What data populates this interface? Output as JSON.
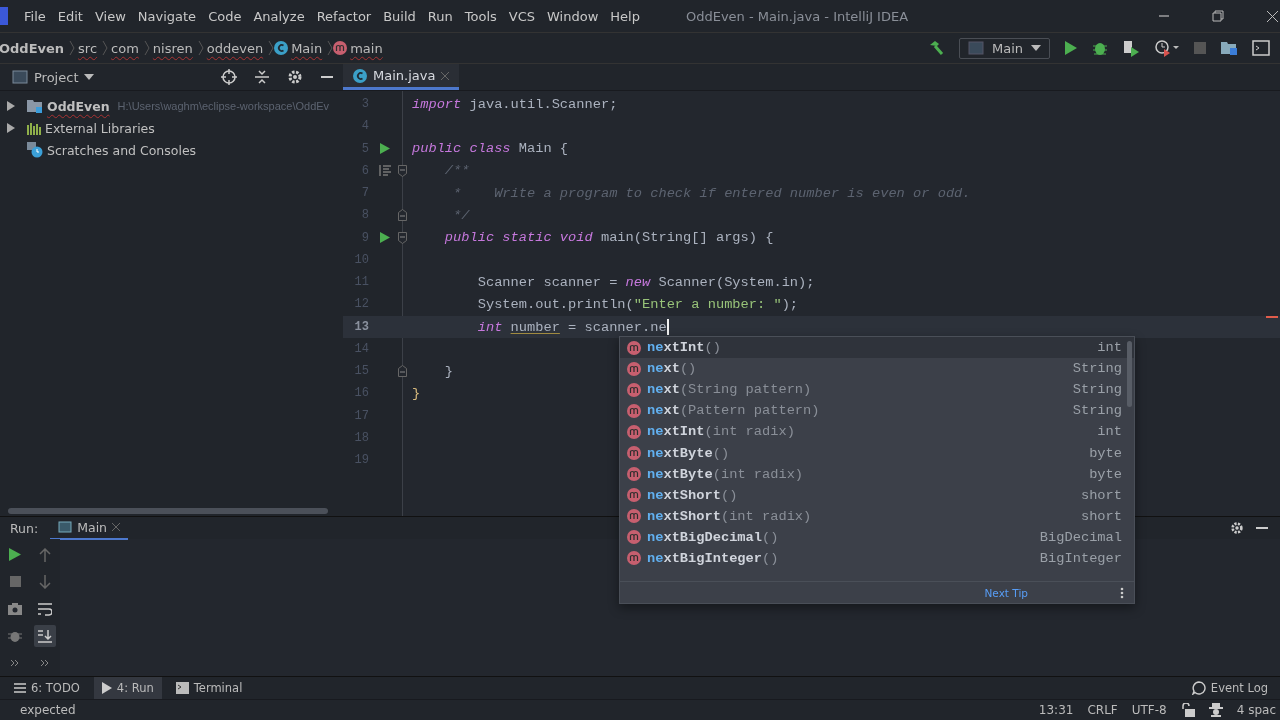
{
  "window": {
    "title": "OddEven - Main.java - IntelliJ IDEA"
  },
  "menu": [
    "File",
    "Edit",
    "View",
    "Navigate",
    "Code",
    "Analyze",
    "Refactor",
    "Build",
    "Run",
    "Tools",
    "VCS",
    "Window",
    "Help"
  ],
  "breadcrumbs": [
    {
      "label": "OddEven",
      "kind": "project"
    },
    {
      "label": "src",
      "kind": "folder"
    },
    {
      "label": "com",
      "kind": "folder"
    },
    {
      "label": "nisren",
      "kind": "folder"
    },
    {
      "label": "oddeven",
      "kind": "folder"
    },
    {
      "label": "Main",
      "kind": "class"
    },
    {
      "label": "main",
      "kind": "method"
    }
  ],
  "run_config": {
    "label": "Main"
  },
  "project_panel": {
    "title": "Project",
    "tree": [
      {
        "label": "OddEven",
        "path": "H:\\Users\\waghm\\eclipse-workspace\\OddEv",
        "kind": "module",
        "expanded": false
      },
      {
        "label": "External Libraries",
        "kind": "libraries",
        "expanded": false
      },
      {
        "label": "Scratches and Consoles",
        "kind": "scratches"
      }
    ]
  },
  "editor": {
    "tabs": [
      {
        "label": "Main.java",
        "selected": true
      }
    ],
    "lines": [
      {
        "number": "3",
        "current": false,
        "runnable": false,
        "doc": false,
        "fold_open": false,
        "fold_close": false,
        "tokens": [
          {
            "kind": "keyword",
            "text": "import"
          },
          {
            "kind": "plain",
            "text": " java.util.Scanner;"
          }
        ]
      },
      {
        "number": "4",
        "current": false,
        "runnable": false,
        "doc": false,
        "fold_open": false,
        "fold_close": false
      },
      {
        "number": "5",
        "current": false,
        "runnable": true,
        "doc": false,
        "fold_open": false,
        "fold_close": false,
        "tokens": [
          {
            "kind": "keyword",
            "text": "public class"
          },
          {
            "kind": "plain",
            "text": " Main {"
          }
        ]
      },
      {
        "number": "6",
        "current": false,
        "runnable": false,
        "doc": true,
        "fold_open": true,
        "fold_close": false,
        "tokens": [
          {
            "kind": "comment",
            "text": "    /**"
          }
        ]
      },
      {
        "number": "7",
        "current": false,
        "runnable": false,
        "doc": false,
        "fold_open": false,
        "fold_close": false,
        "tokens": [
          {
            "kind": "comment",
            "text": "     *    Write a program to check if entered number is even or odd."
          }
        ]
      },
      {
        "number": "8",
        "current": false,
        "runnable": false,
        "doc": false,
        "fold_open": false,
        "fold_close": true,
        "tokens": [
          {
            "kind": "comment",
            "text": "     */"
          }
        ]
      },
      {
        "number": "9",
        "current": false,
        "runnable": true,
        "doc": false,
        "fold_open": true,
        "fold_close": false,
        "tokens": [
          {
            "kind": "keyword",
            "text": "    public static void"
          },
          {
            "kind": "plain",
            "text": " main(String[] args) {"
          }
        ]
      },
      {
        "number": "10",
        "current": false,
        "runnable": false,
        "doc": false,
        "fold_open": false,
        "fold_close": false
      },
      {
        "number": "11",
        "current": false,
        "runnable": false,
        "doc": false,
        "fold_open": false,
        "fold_close": false,
        "tokens": [
          {
            "kind": "plain",
            "text": "        Scanner scanner = "
          },
          {
            "kind": "keyword",
            "text": "new"
          },
          {
            "kind": "plain",
            "text": " Scanner(System.in);"
          }
        ]
      },
      {
        "number": "12",
        "current": false,
        "runnable": false,
        "doc": false,
        "fold_open": false,
        "fold_close": false,
        "tokens": [
          {
            "kind": "plain",
            "text": "        System.out.println("
          },
          {
            "kind": "string",
            "text": "\"Enter a number: \""
          },
          {
            "kind": "plain",
            "text": ");"
          }
        ]
      },
      {
        "number": "13",
        "current": true,
        "runnable": false,
        "doc": false,
        "fold_open": false,
        "fold_close": false,
        "tokens": [
          {
            "kind": "keyword",
            "text": "        int "
          },
          {
            "kind": "warning",
            "text": "number"
          },
          {
            "kind": "plain",
            "text": " = scanner.ne"
          }
        ]
      },
      {
        "number": "14",
        "current": false,
        "runnable": false,
        "doc": false,
        "fold_open": false,
        "fold_close": false
      },
      {
        "number": "15",
        "current": false,
        "runnable": false,
        "doc": false,
        "fold_open": false,
        "fold_close": true,
        "tokens": [
          {
            "kind": "plain",
            "text": "    }"
          }
        ]
      },
      {
        "number": "16",
        "current": false,
        "runnable": false,
        "doc": false,
        "fold_open": false,
        "fold_close": false,
        "tokens": [
          {
            "kind": "brace",
            "text": "}"
          }
        ]
      },
      {
        "number": "17",
        "current": false,
        "runnable": false,
        "doc": false,
        "fold_open": false,
        "fold_close": false
      },
      {
        "number": "18",
        "current": false,
        "runnable": false,
        "doc": false,
        "fold_open": false,
        "fold_close": false
      },
      {
        "number": "19",
        "current": false,
        "runnable": false,
        "doc": false,
        "fold_open": false,
        "fold_close": false
      }
    ]
  },
  "completion": {
    "items": [
      {
        "match": "ne",
        "rest": "xtInt",
        "params": "()",
        "type": "int",
        "selected": true
      },
      {
        "match": "ne",
        "rest": "xt",
        "params": "()",
        "type": "String",
        "selected": false
      },
      {
        "match": "ne",
        "rest": "xt",
        "params": "(String pattern)",
        "type": "String",
        "selected": false
      },
      {
        "match": "ne",
        "rest": "xt",
        "params": "(Pattern pattern)",
        "type": "String",
        "selected": false
      },
      {
        "match": "ne",
        "rest": "xtInt",
        "params": "(int radix)",
        "type": "int",
        "selected": false
      },
      {
        "match": "ne",
        "rest": "xtByte",
        "params": "()",
        "type": "byte",
        "selected": false
      },
      {
        "match": "ne",
        "rest": "xtByte",
        "params": "(int radix)",
        "type": "byte",
        "selected": false
      },
      {
        "match": "ne",
        "rest": "xtShort",
        "params": "()",
        "type": "short",
        "selected": false
      },
      {
        "match": "ne",
        "rest": "xtShort",
        "params": "(int radix)",
        "type": "short",
        "selected": false
      },
      {
        "match": "ne",
        "rest": "xtBigDecimal",
        "params": "()",
        "type": "BigDecimal",
        "selected": false
      },
      {
        "match": "ne",
        "rest": "xtBigInteger",
        "params": "()",
        "type": "BigInteger",
        "selected": false
      }
    ],
    "tip_link": "Next Tip"
  },
  "run_panel": {
    "label": "Run:",
    "tabs": [
      {
        "label": "Main",
        "selected": true
      }
    ]
  },
  "tool_tabs": [
    {
      "kind": "todo",
      "label": "6: TODO",
      "selected": false
    },
    {
      "kind": "run",
      "label": "4: Run",
      "selected": true
    },
    {
      "kind": "terminal",
      "label": "Terminal",
      "selected": false
    }
  ],
  "event_log": "Event Log",
  "status_bar": {
    "message": "expected",
    "position": "13:31",
    "line_separator": "CRLF",
    "encoding": "UTF-8",
    "indent": "4 spac"
  }
}
